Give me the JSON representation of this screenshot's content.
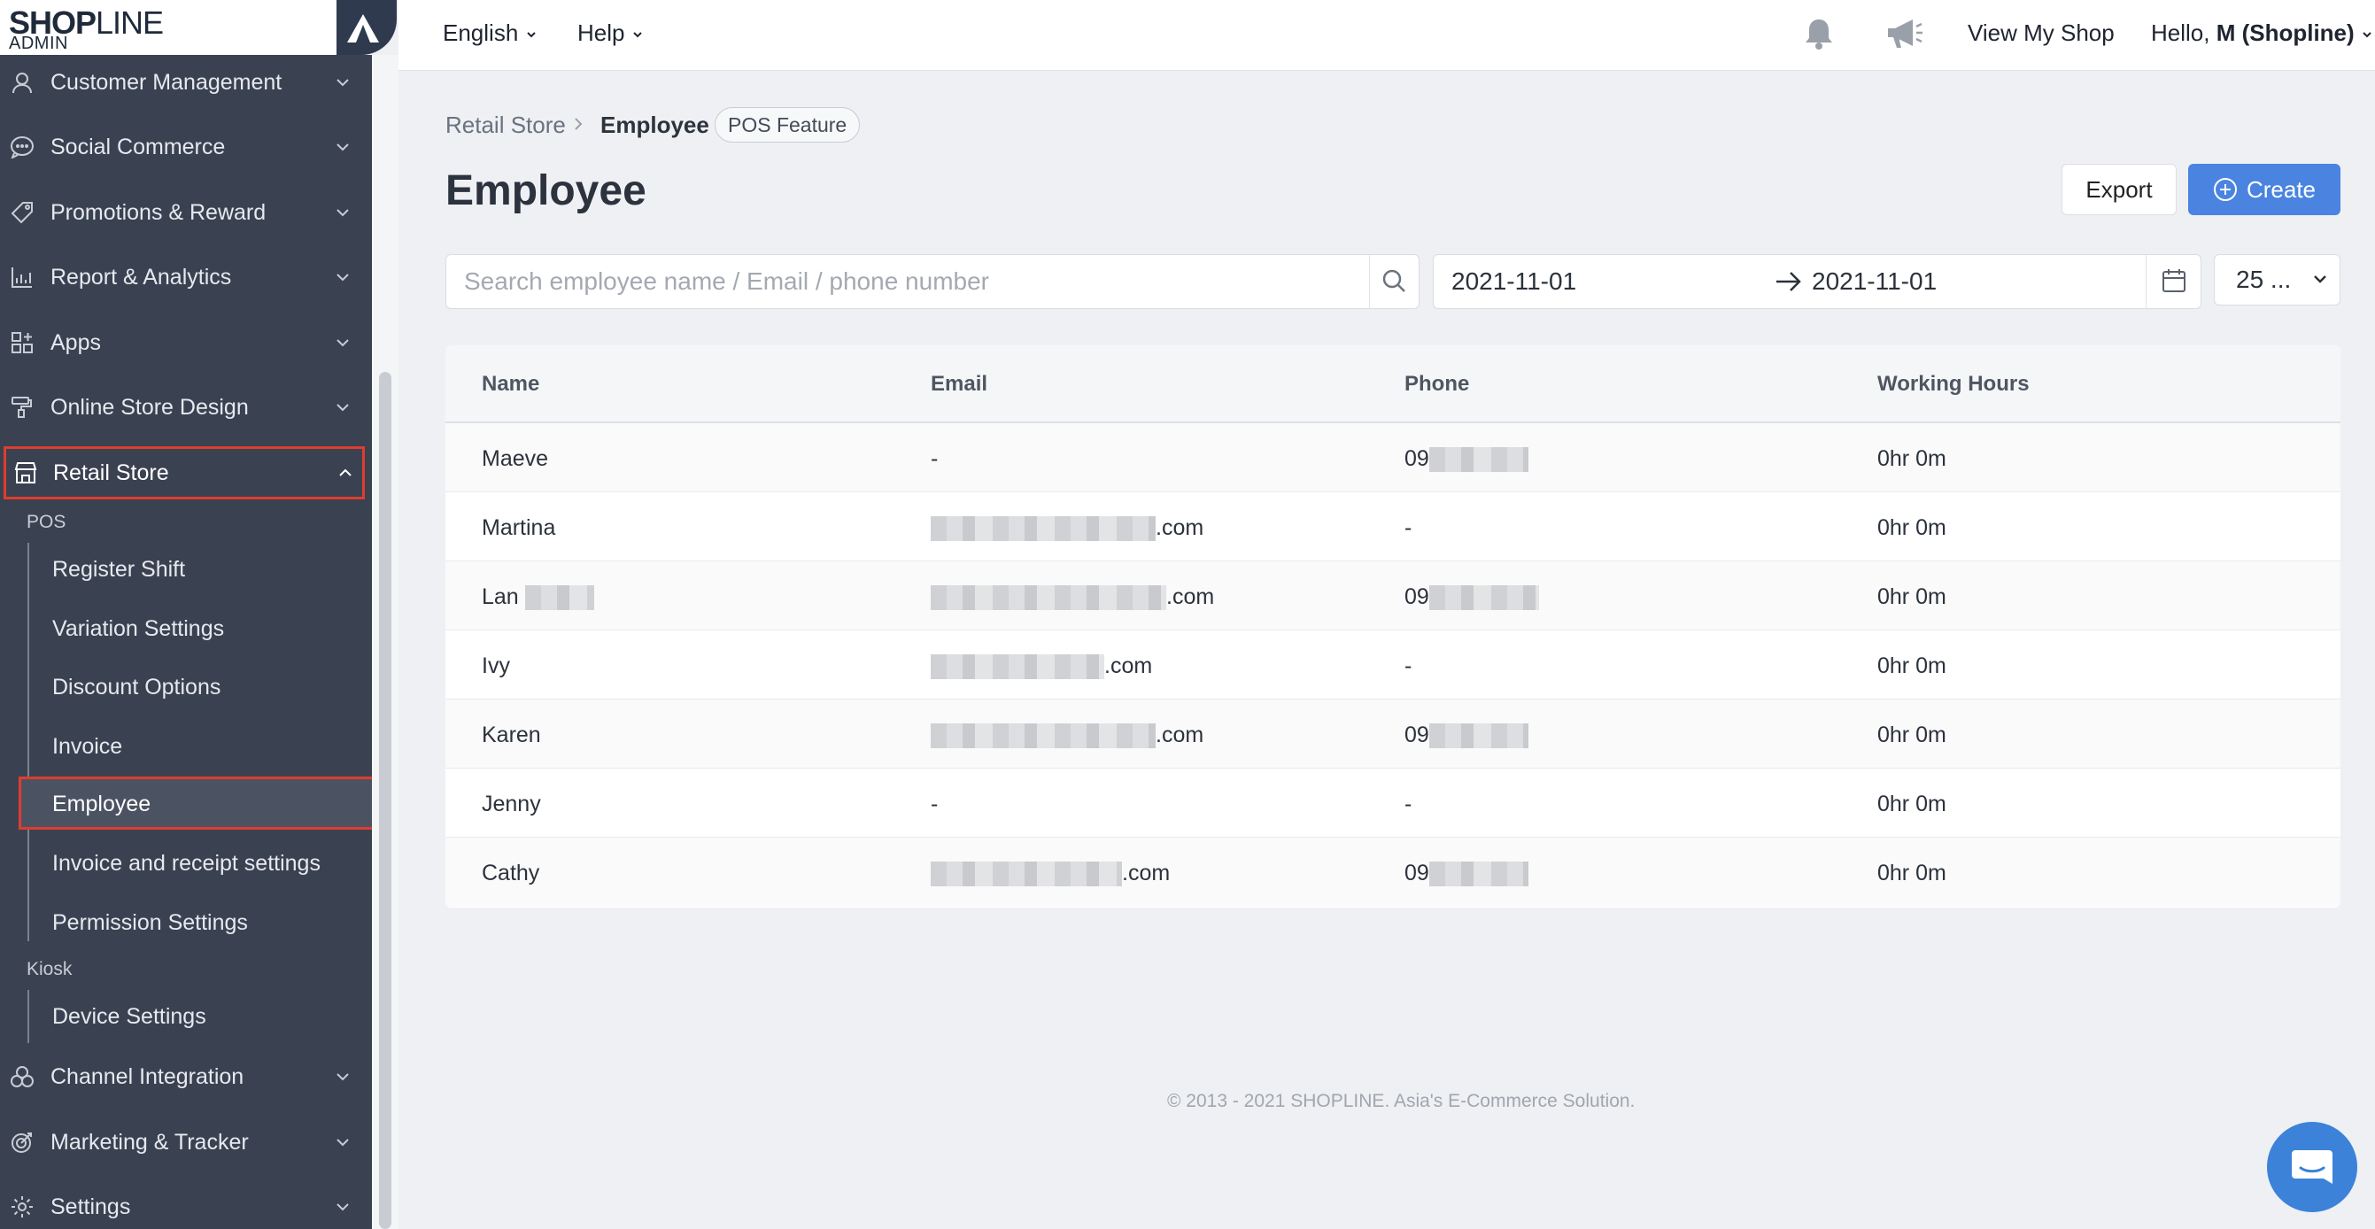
{
  "brand": {
    "logo_bold": "SHOP",
    "logo_light": "LINE",
    "sub": "ADMIN"
  },
  "topbar": {
    "language": "English",
    "help": "Help",
    "view_shop": "View My Shop",
    "greeting_prefix": "Hello, ",
    "greeting_user": "M (Shopline)"
  },
  "sidebar": {
    "top_items": [
      {
        "label": "Customer Management",
        "icon": "user-icon"
      },
      {
        "label": "Social Commerce",
        "icon": "chat-bubble-icon"
      },
      {
        "label": "Promotions & Reward",
        "icon": "tag-icon"
      },
      {
        "label": "Report & Analytics",
        "icon": "bar-chart-icon"
      },
      {
        "label": "Apps",
        "icon": "apps-grid-icon"
      },
      {
        "label": "Online Store Design",
        "icon": "paint-roller-icon"
      }
    ],
    "retail_store": {
      "label": "Retail Store",
      "icon": "store-icon"
    },
    "pos_label": "POS",
    "pos_items": [
      "Register Shift",
      "Variation Settings",
      "Discount Options",
      "Invoice",
      "Employee",
      "Invoice and receipt settings",
      "Permission Settings"
    ],
    "kiosk_label": "Kiosk",
    "kiosk_items": [
      "Device Settings"
    ],
    "bottom_items": [
      {
        "label": "Channel Integration",
        "icon": "channels-icon"
      },
      {
        "label": "Marketing & Tracker",
        "icon": "target-icon"
      },
      {
        "label": "Settings",
        "icon": "gear-icon"
      }
    ]
  },
  "breadcrumb": {
    "parent": "Retail Store",
    "current": "Employee",
    "badge": "POS Feature"
  },
  "page": {
    "title": "Employee",
    "export_label": "Export",
    "create_label": "Create"
  },
  "filters": {
    "search_placeholder": "Search employee name / Email / phone number",
    "date_from": "2021-11-01",
    "date_to": "2021-11-01",
    "per_page": "25 ..."
  },
  "table": {
    "columns": [
      "Name",
      "Email",
      "Phone",
      "Working Hours"
    ],
    "rows": [
      {
        "name": "Maeve",
        "email": "-",
        "phone": "09",
        "hours": "0hr 0m"
      },
      {
        "name": "Martina",
        "email": ".com",
        "phone": "-",
        "hours": "0hr 0m"
      },
      {
        "name": "Lan",
        "email": ".com",
        "phone": "09",
        "hours": "0hr 0m"
      },
      {
        "name": "Ivy",
        "email": ".com",
        "phone": "-",
        "hours": "0hr 0m"
      },
      {
        "name": "Karen",
        "email": ".com",
        "phone": "09",
        "hours": "0hr 0m"
      },
      {
        "name": "Jenny",
        "email": "-",
        "phone": "-",
        "hours": "0hr 0m"
      },
      {
        "name": "Cathy",
        "email": ".com",
        "phone": "09",
        "hours": "0hr 0m"
      }
    ]
  },
  "footer": "© 2013 - 2021 SHOPLINE. Asia's E-Commerce Solution.",
  "colors": {
    "sidebar_bg": "#3a4252",
    "highlight": "#e03c2d",
    "primary": "#4a84e0"
  }
}
